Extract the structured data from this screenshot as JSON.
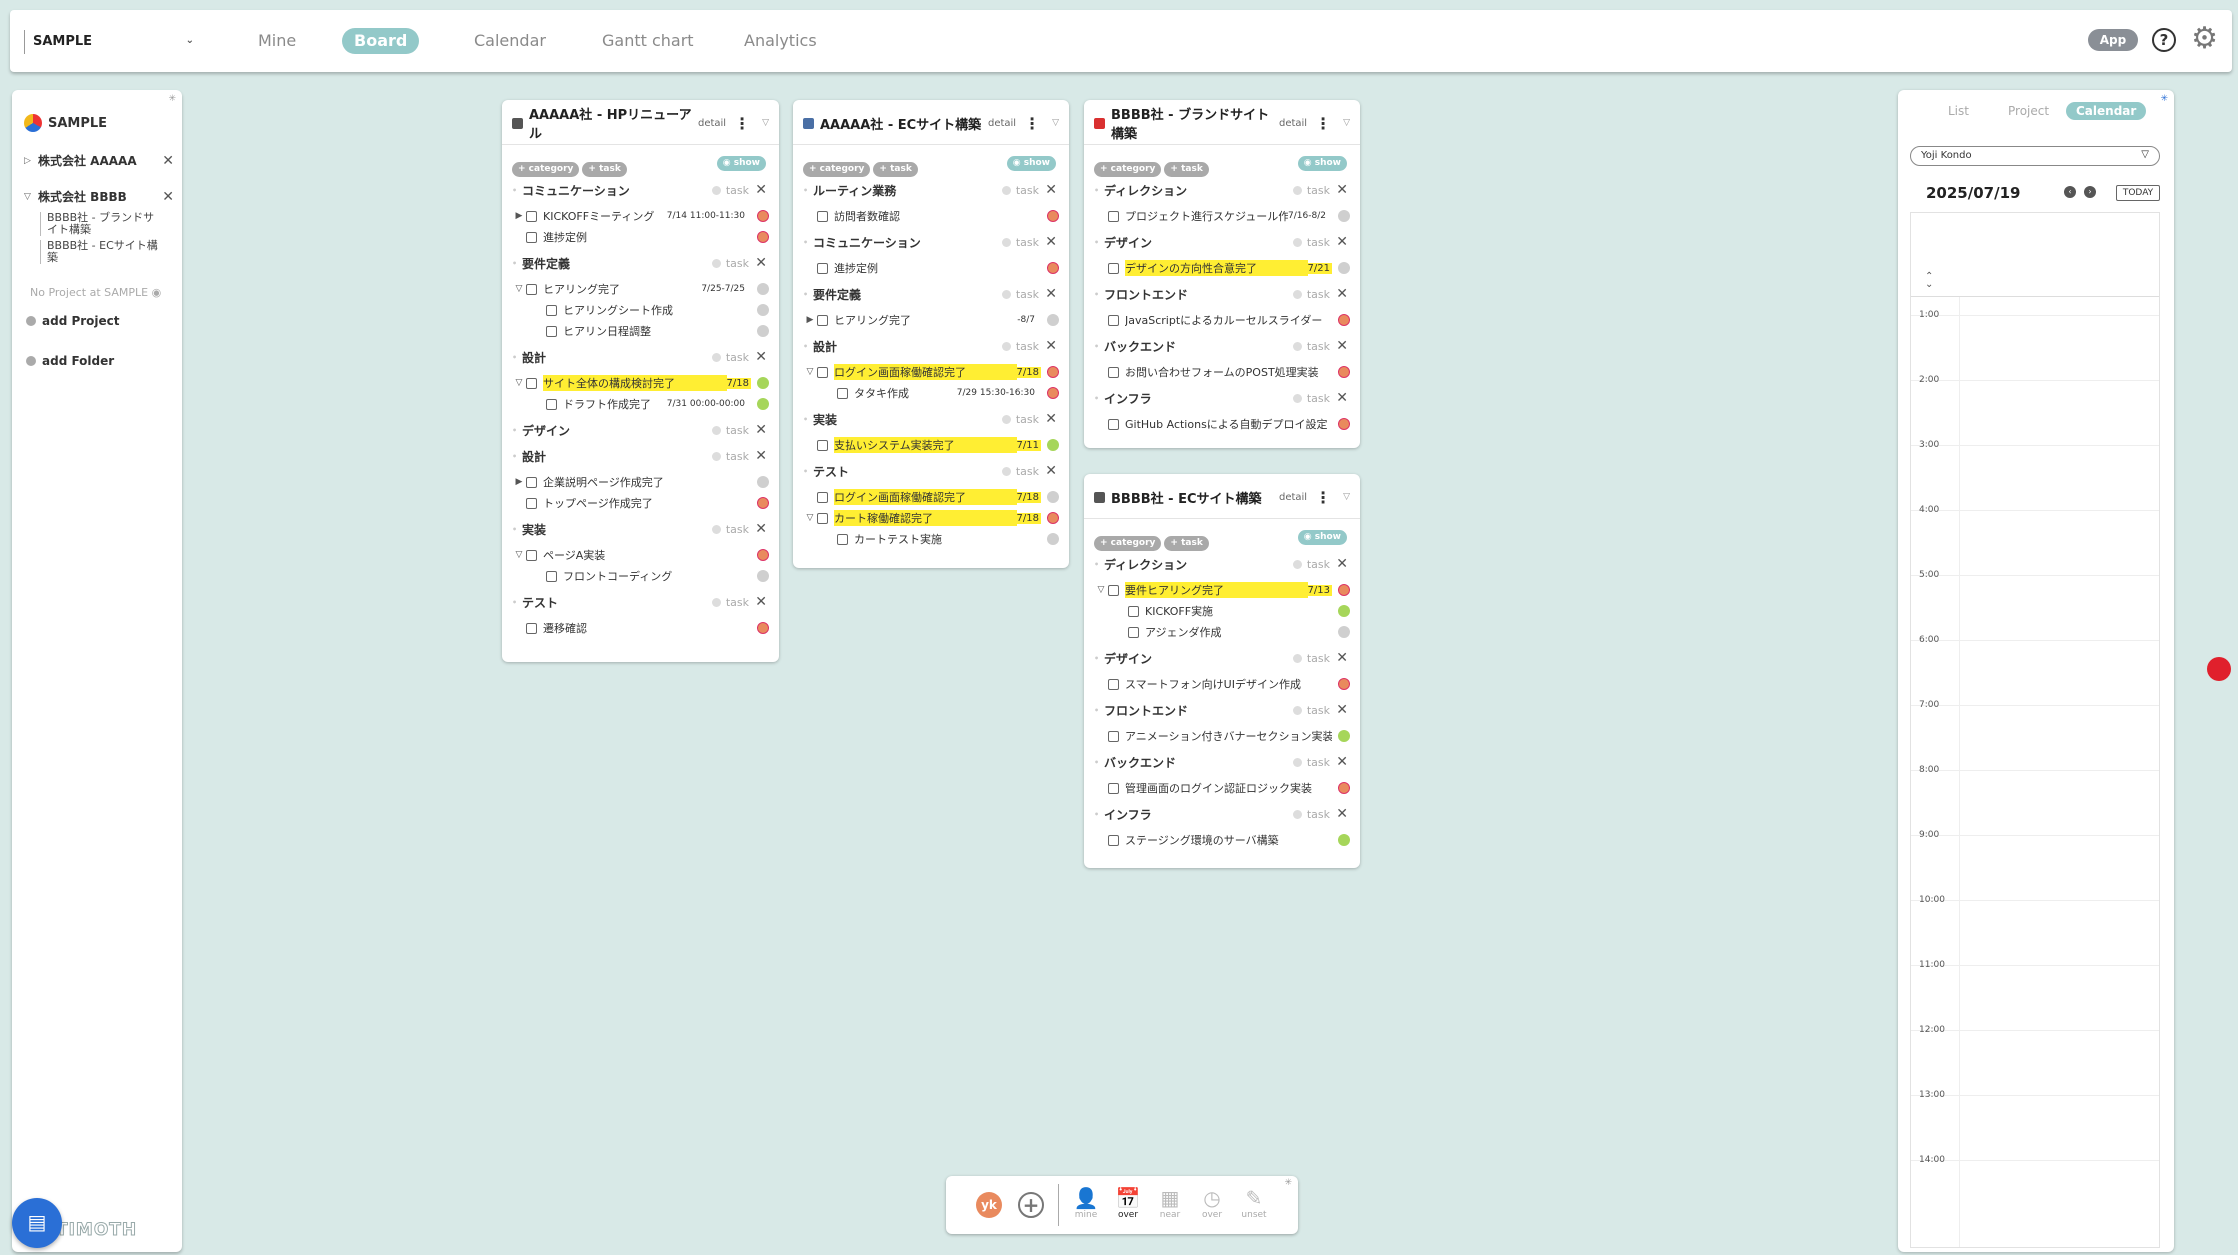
{
  "topbar": {
    "workspace": "SAMPLE",
    "nav": [
      "Mine",
      "Board",
      "Calendar",
      "Gantt chart",
      "Analytics"
    ],
    "active_nav": "Board",
    "app_label": "App"
  },
  "sidebar": {
    "title": "SAMPLE",
    "folders": [
      {
        "name": "株式会社 AAAAA",
        "projects": []
      },
      {
        "name": "株式会社 BBBB",
        "projects": [
          "BBBB社 - ブランドサイト構築",
          "BBBB社 - ECサイト構築"
        ]
      }
    ],
    "no_project": "No Project at SAMPLE",
    "add_project": "add Project",
    "add_folder": "add Folder",
    "brand": "TIMOTH"
  },
  "card_common": {
    "detail": "detail",
    "add_category": "+ category",
    "add_task": "+ task",
    "show": "show",
    "task": "task"
  },
  "cards": [
    {
      "title": "AAAAA社 - HPリニューアル",
      "color": "#555555",
      "rows": [
        {
          "type": "cat",
          "name": "コミュニケーション"
        },
        {
          "type": "task",
          "exp": "▶",
          "name": "KICKOFFミーティング",
          "date": "7/14 11:00-11:30",
          "av": "orange"
        },
        {
          "type": "task",
          "name": "進捗定例",
          "av": "orange"
        },
        {
          "type": "cat",
          "name": "要件定義"
        },
        {
          "type": "task",
          "exp": "▽",
          "name": "ヒアリング完了",
          "date": "7/25-7/25",
          "av": "gray"
        },
        {
          "type": "sub",
          "name": "ヒアリングシート作成",
          "av": "gray"
        },
        {
          "type": "sub",
          "name": "ヒアリン日程調整",
          "av": "gray"
        },
        {
          "type": "cat",
          "name": "設計"
        },
        {
          "type": "task",
          "exp": "▽",
          "name": "サイト全体の構成検討完了",
          "date": "7/18",
          "hl": true,
          "av": "green"
        },
        {
          "type": "sub",
          "name": "ドラフト作成完了",
          "date": "7/31 00:00-00:00",
          "av": "green"
        },
        {
          "type": "cat",
          "name": "デザイン"
        },
        {
          "type": "cat",
          "name": "設計"
        },
        {
          "type": "task",
          "exp": "▶",
          "name": "企業説明ページ作成完了",
          "av": "gray"
        },
        {
          "type": "task",
          "name": "トップページ作成完了",
          "av": "orange"
        },
        {
          "type": "cat",
          "name": "実装"
        },
        {
          "type": "task",
          "exp": "▽",
          "name": "ページA実装",
          "av": "orange"
        },
        {
          "type": "sub",
          "name": "フロントコーディング",
          "av": "gray"
        },
        {
          "type": "cat",
          "name": "テスト"
        },
        {
          "type": "task",
          "name": "遷移確認",
          "av": "orange"
        }
      ]
    },
    {
      "title": "AAAAA社 - ECサイト構築",
      "color": "#4a6fa5",
      "rows": [
        {
          "type": "cat",
          "name": "ルーティン業務"
        },
        {
          "type": "task",
          "name": "訪問者数確認",
          "av": "orange"
        },
        {
          "type": "cat",
          "name": "コミュニケーション"
        },
        {
          "type": "task",
          "name": "進捗定例",
          "av": "orange"
        },
        {
          "type": "cat",
          "name": "要件定義"
        },
        {
          "type": "task",
          "exp": "▶",
          "name": "ヒアリング完了",
          "date": "-8/7",
          "av": "gray"
        },
        {
          "type": "cat",
          "name": "設計"
        },
        {
          "type": "task",
          "exp": "▽",
          "name": "ログイン画面稼働確認完了",
          "date": "7/18",
          "hl": true,
          "av": "orange"
        },
        {
          "type": "sub",
          "name": "タタキ作成",
          "date": "7/29 15:30-16:30",
          "av": "orange"
        },
        {
          "type": "cat",
          "name": "実装"
        },
        {
          "type": "task",
          "name": "支払いシステム実装完了",
          "date": "7/11",
          "hl": true,
          "av": "green"
        },
        {
          "type": "cat",
          "name": "テスト"
        },
        {
          "type": "task",
          "name": "ログイン画面稼働確認完了",
          "date": "7/18",
          "hl": true,
          "av": "gray"
        },
        {
          "type": "task",
          "exp": "▽",
          "name": "カート稼働確認完了",
          "date": "7/18",
          "hl": true,
          "av": "orange"
        },
        {
          "type": "sub",
          "name": "カートテスト実施",
          "av": "gray"
        }
      ]
    },
    {
      "title": "BBBB社 - ブランドサイト構築",
      "color": "#d93030",
      "rows": [
        {
          "type": "cat",
          "name": "ディレクション"
        },
        {
          "type": "task",
          "name": "プロジェクト進行スケジュール作成",
          "date": "7/16-8/2",
          "av": "gray"
        },
        {
          "type": "cat",
          "name": "デザイン"
        },
        {
          "type": "task",
          "name": "デザインの方向性合意完了",
          "date": "7/21",
          "hl": true,
          "av": "gray"
        },
        {
          "type": "cat",
          "name": "フロントエンド"
        },
        {
          "type": "task",
          "name": "JavaScriptによるカルーセルスライダー",
          "av": "orange"
        },
        {
          "type": "cat",
          "name": "バックエンド"
        },
        {
          "type": "task",
          "name": "お問い合わせフォームのPOST処理実装",
          "av": "orange"
        },
        {
          "type": "cat",
          "name": "インフラ"
        },
        {
          "type": "task",
          "name": "GitHub Actionsによる自動デプロイ設定",
          "av": "orange"
        }
      ]
    },
    {
      "title": "BBBB社 - ECサイト構築",
      "color": "#555555",
      "rows": [
        {
          "type": "cat",
          "name": "ディレクション"
        },
        {
          "type": "task",
          "exp": "▽",
          "name": "要件ヒアリング完了",
          "date": "7/13",
          "hl": true,
          "av": "orange"
        },
        {
          "type": "sub",
          "name": "KICKOFF実施",
          "av": "green"
        },
        {
          "type": "sub",
          "name": "アジェンダ作成",
          "av": "gray"
        },
        {
          "type": "cat",
          "name": "デザイン"
        },
        {
          "type": "task",
          "name": "スマートフォン向けUIデザイン作成",
          "av": "orange"
        },
        {
          "type": "cat",
          "name": "フロントエンド"
        },
        {
          "type": "task",
          "name": "アニメーション付きバナーセクション実装",
          "av": "green"
        },
        {
          "type": "cat",
          "name": "バックエンド"
        },
        {
          "type": "task",
          "name": "管理画面のログイン認証ロジック実装",
          "av": "orange"
        },
        {
          "type": "cat",
          "name": "インフラ"
        },
        {
          "type": "task",
          "name": "ステージング環境のサーバ構築",
          "av": "green"
        }
      ]
    }
  ],
  "calendar_panel": {
    "tabs": [
      "List",
      "Project",
      "Calendar"
    ],
    "active_tab": "Calendar",
    "user": "Yoji Kondo",
    "date": "2025/07/19",
    "today_label": "TODAY",
    "hours": [
      "1:00",
      "2:00",
      "3:00",
      "4:00",
      "5:00",
      "6:00",
      "7:00",
      "8:00",
      "9:00",
      "10:00",
      "11:00",
      "12:00",
      "13:00",
      "14:00"
    ]
  },
  "bottombar": {
    "avatar": "yk",
    "filters": [
      {
        "label": "mine",
        "icon": "person-icon"
      },
      {
        "label": "over",
        "icon": "calendar-icon"
      },
      {
        "label": "near",
        "icon": "calendar-outline-icon"
      },
      {
        "label": "over",
        "icon": "clock-icon"
      },
      {
        "label": "unset",
        "icon": "feather-icon"
      }
    ],
    "active_filter": "over"
  }
}
